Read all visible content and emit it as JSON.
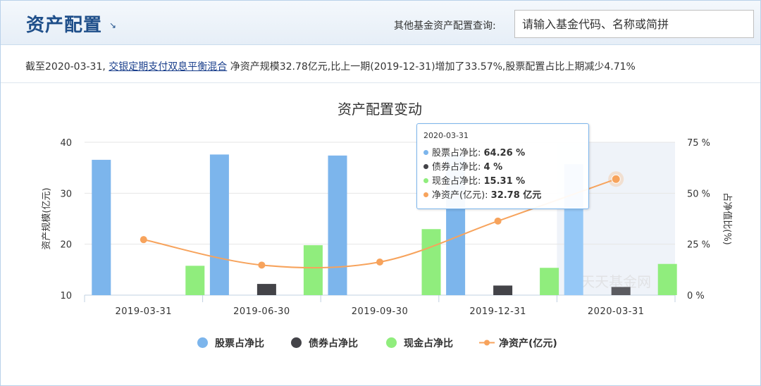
{
  "header": {
    "title": "资产配置",
    "search_label": "其他基金资产配置查询:",
    "search_placeholder": "请输入基金代码、名称或简拼"
  },
  "summary": {
    "prefix": "截至2020-03-31,",
    "fund_link": "交银定期支付双息平衡混合",
    "suffix": "净资产规模32.78亿元,比上一期(2019-12-31)增加了33.57%,股票配置占比上期减少4.71%"
  },
  "tooltip": {
    "date": "2020-03-31",
    "rows": [
      {
        "label": "股票占净比: ",
        "value": "64.26 %",
        "color": "#7cb5ec"
      },
      {
        "label": "债券占净比: ",
        "value": "4 %",
        "color": "#434348"
      },
      {
        "label": "现金占净比: ",
        "value": "15.31 %",
        "color": "#90ed7d"
      },
      {
        "label": "净资产(亿元): ",
        "value": "32.78 亿元",
        "color": "#f7a35c"
      }
    ]
  },
  "chart_data": {
    "type": "bar",
    "title": "资产配置变动",
    "categories": [
      "2019-03-31",
      "2019-06-30",
      "2019-09-30",
      "2019-12-31",
      "2020-03-31"
    ],
    "series": [
      {
        "name": "股票占净比",
        "axis": "right",
        "type": "bar",
        "color": "#7cb5ec",
        "values": [
          66.4,
          69.0,
          68.5,
          68.97,
          64.26
        ]
      },
      {
        "name": "债券占净比",
        "axis": "right",
        "type": "bar",
        "color": "#434348",
        "values": [
          0,
          5.5,
          0,
          4.7,
          4
        ]
      },
      {
        "name": "现金占净比",
        "axis": "right",
        "type": "bar",
        "color": "#90ed7d",
        "values": [
          14.4,
          24.5,
          32.4,
          13.4,
          15.31
        ]
      },
      {
        "name": "净资产(亿元)",
        "axis": "left",
        "type": "line",
        "color": "#f7a35c",
        "values": [
          20.9,
          15.9,
          16.5,
          24.54,
          32.78
        ]
      }
    ],
    "yleft": {
      "label": "资产规模(亿元)",
      "ylim": [
        10,
        40
      ],
      "ticks": [
        "10",
        "20",
        "30",
        "40"
      ]
    },
    "yright": {
      "label": "占净值比(%)",
      "ylim": [
        0,
        75
      ],
      "ticks": [
        "0 %",
        "25 %",
        "50 %",
        "75 %"
      ]
    },
    "highlight_index": 4,
    "watermark": "天天基金网",
    "legend_placement": "bottom",
    "grid": true
  }
}
